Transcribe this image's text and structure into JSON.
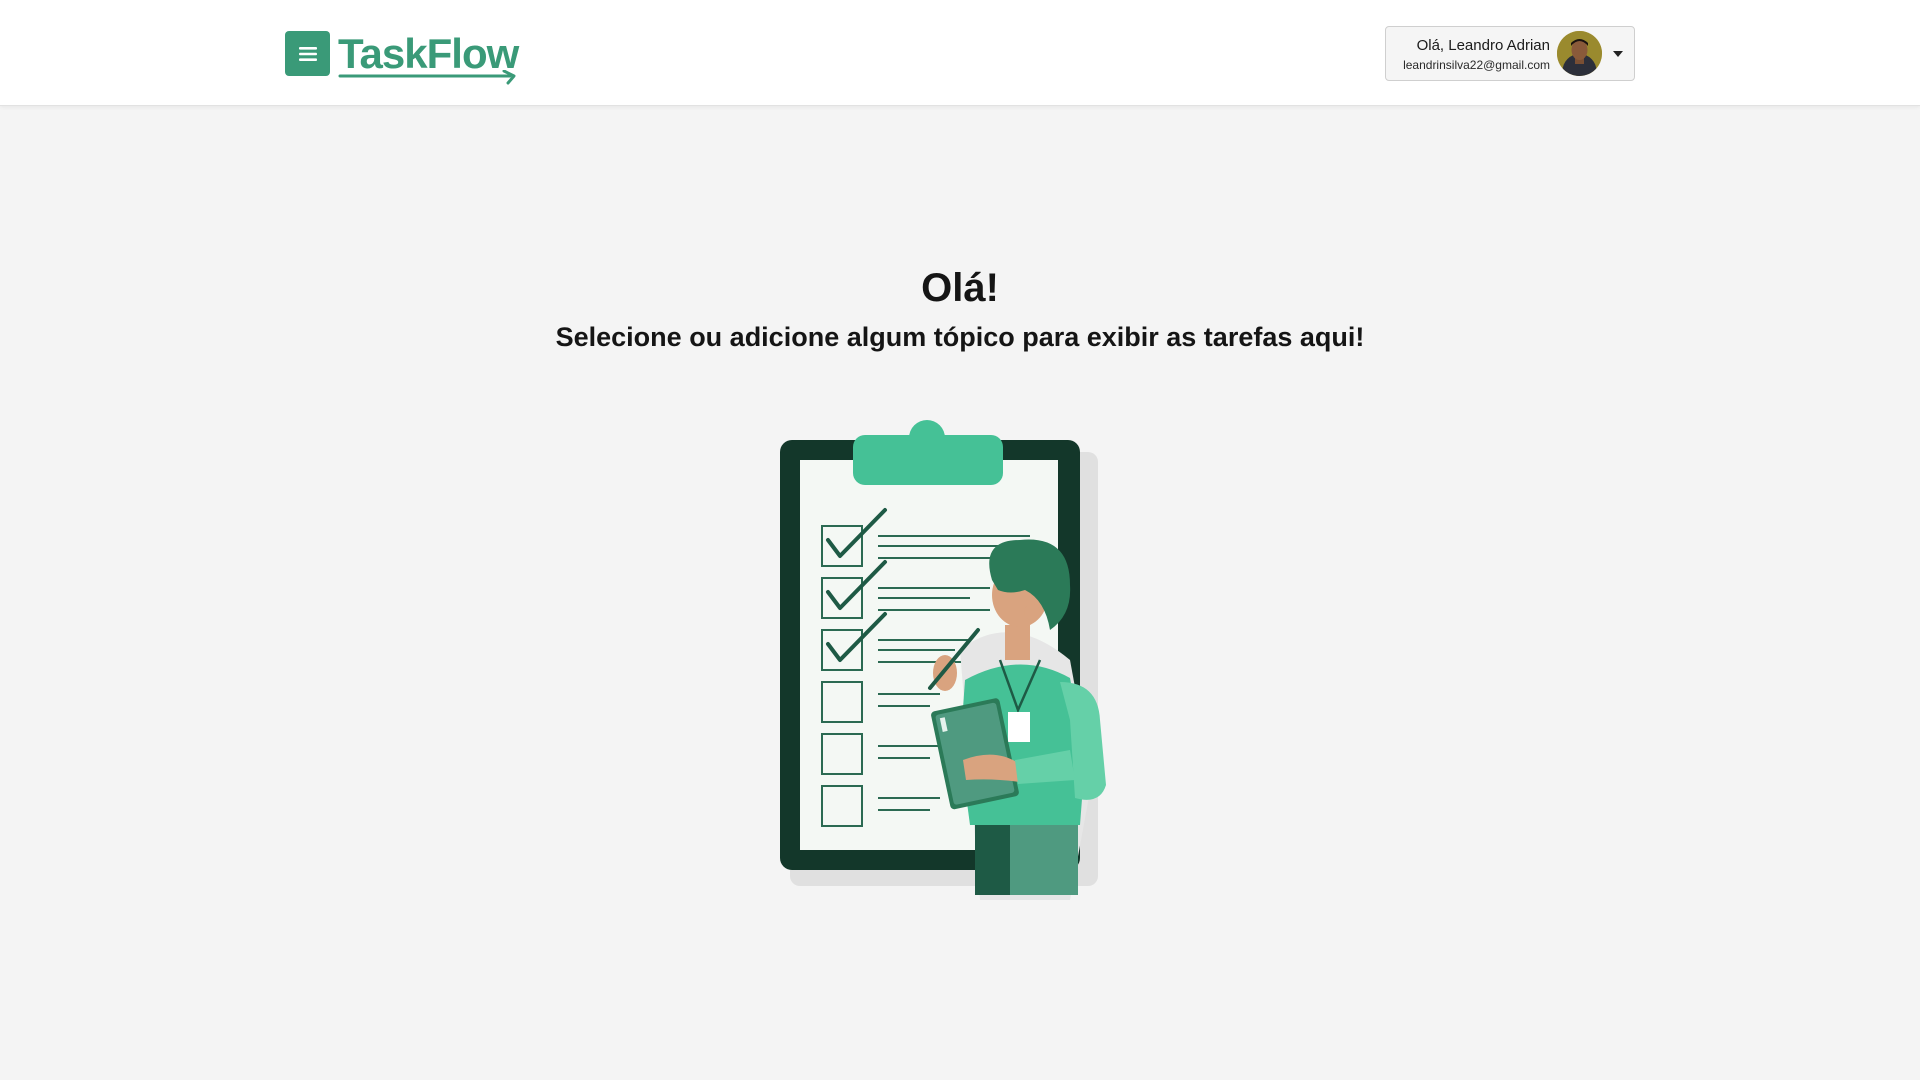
{
  "header": {
    "menu_icon": "hamburger-menu-icon",
    "logo_text": "TaskFlow",
    "brand_color": "#3a9a78"
  },
  "user": {
    "greeting": "Olá, Leandro Adrian",
    "email": "leandrinsilva22@gmail.com",
    "dropdown_icon": "caret-down-icon"
  },
  "main": {
    "title": "Olá!",
    "subtitle": "Selecione ou adicione algum tópico para exibir as tarefas aqui!",
    "illustration": "person-with-checklist-illustration"
  },
  "colors": {
    "background": "#f4f4f4",
    "accent": "#3a9a78",
    "accent_light": "#45c196",
    "dark_green": "#1e5a45"
  }
}
